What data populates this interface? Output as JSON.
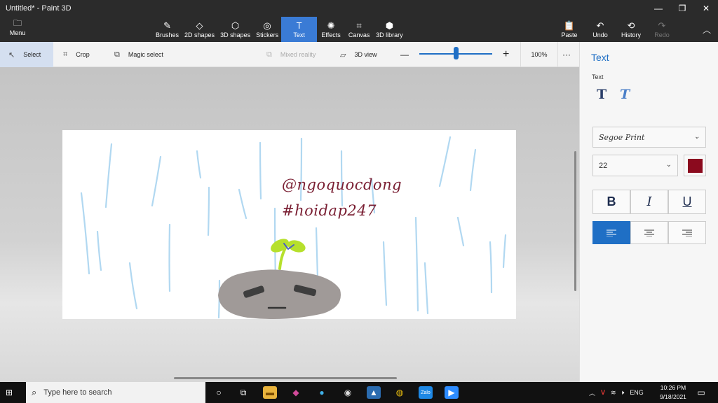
{
  "window": {
    "title": "Untitled* - Paint 3D"
  },
  "menu": {
    "label": "Menu"
  },
  "ribbon": {
    "tools": [
      {
        "label": "Brushes",
        "icon": "brush-icon"
      },
      {
        "label": "2D shapes",
        "icon": "2d-shapes-icon"
      },
      {
        "label": "3D shapes",
        "icon": "3d-shapes-icon"
      },
      {
        "label": "Stickers",
        "icon": "stickers-icon"
      },
      {
        "label": "Text",
        "icon": "text-icon"
      },
      {
        "label": "Effects",
        "icon": "effects-icon"
      },
      {
        "label": "Canvas",
        "icon": "canvas-icon"
      },
      {
        "label": "3D library",
        "icon": "3d-library-icon"
      }
    ],
    "actions": [
      {
        "label": "Paste",
        "icon": "paste-icon"
      },
      {
        "label": "Undo",
        "icon": "undo-icon"
      },
      {
        "label": "History",
        "icon": "history-icon"
      },
      {
        "label": "Redo",
        "icon": "redo-icon"
      }
    ]
  },
  "subbar": {
    "select": "Select",
    "crop": "Crop",
    "magic_select": "Magic select",
    "mixed_reality": "Mixed reality",
    "view_3d": "3D view",
    "zoom_minus": "—",
    "zoom_plus": "+",
    "zoom_level": 100,
    "zoom_label": "100%",
    "more": "···"
  },
  "canvas_text": {
    "line1": "@ngoquocdong",
    "line2": "#hoidap247"
  },
  "panel": {
    "title": "Text",
    "section_label": "Text",
    "font": "Segoe Print",
    "size": "22",
    "text_color": "#8b0a1e",
    "bold": "B",
    "italic": "I",
    "underline": "U"
  },
  "taskbar": {
    "search_placeholder": "Type here to search",
    "language": "ENG",
    "time": "10:26 PM",
    "date": "9/18/2021"
  },
  "colors": {
    "accent": "#1f6fc5",
    "ribbon_bg": "#2b2b2b",
    "text_ink": "#7a1f33"
  }
}
